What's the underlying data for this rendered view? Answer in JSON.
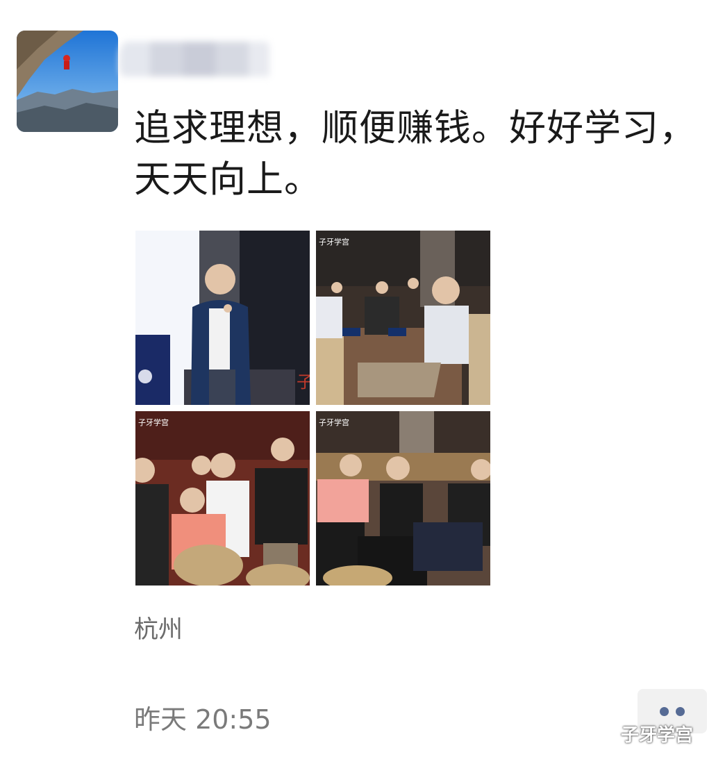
{
  "post": {
    "author_name": "",
    "text": "追求理想，顺便赚钱。好好学习，天天向上。",
    "location": "杭州",
    "timestamp": "昨天 20:55"
  },
  "photos": [
    {
      "id": "photo-1",
      "overlay_text": ""
    },
    {
      "id": "photo-2",
      "overlay_text": "子牙学宫"
    },
    {
      "id": "photo-3",
      "overlay_text": "子牙学宫"
    },
    {
      "id": "photo-4",
      "overlay_text": "子牙学宫"
    }
  ],
  "more_button": {
    "icon": "more-dots-icon"
  },
  "watermark": {
    "icon": "wechat-icon",
    "text": "子牙学宫"
  }
}
